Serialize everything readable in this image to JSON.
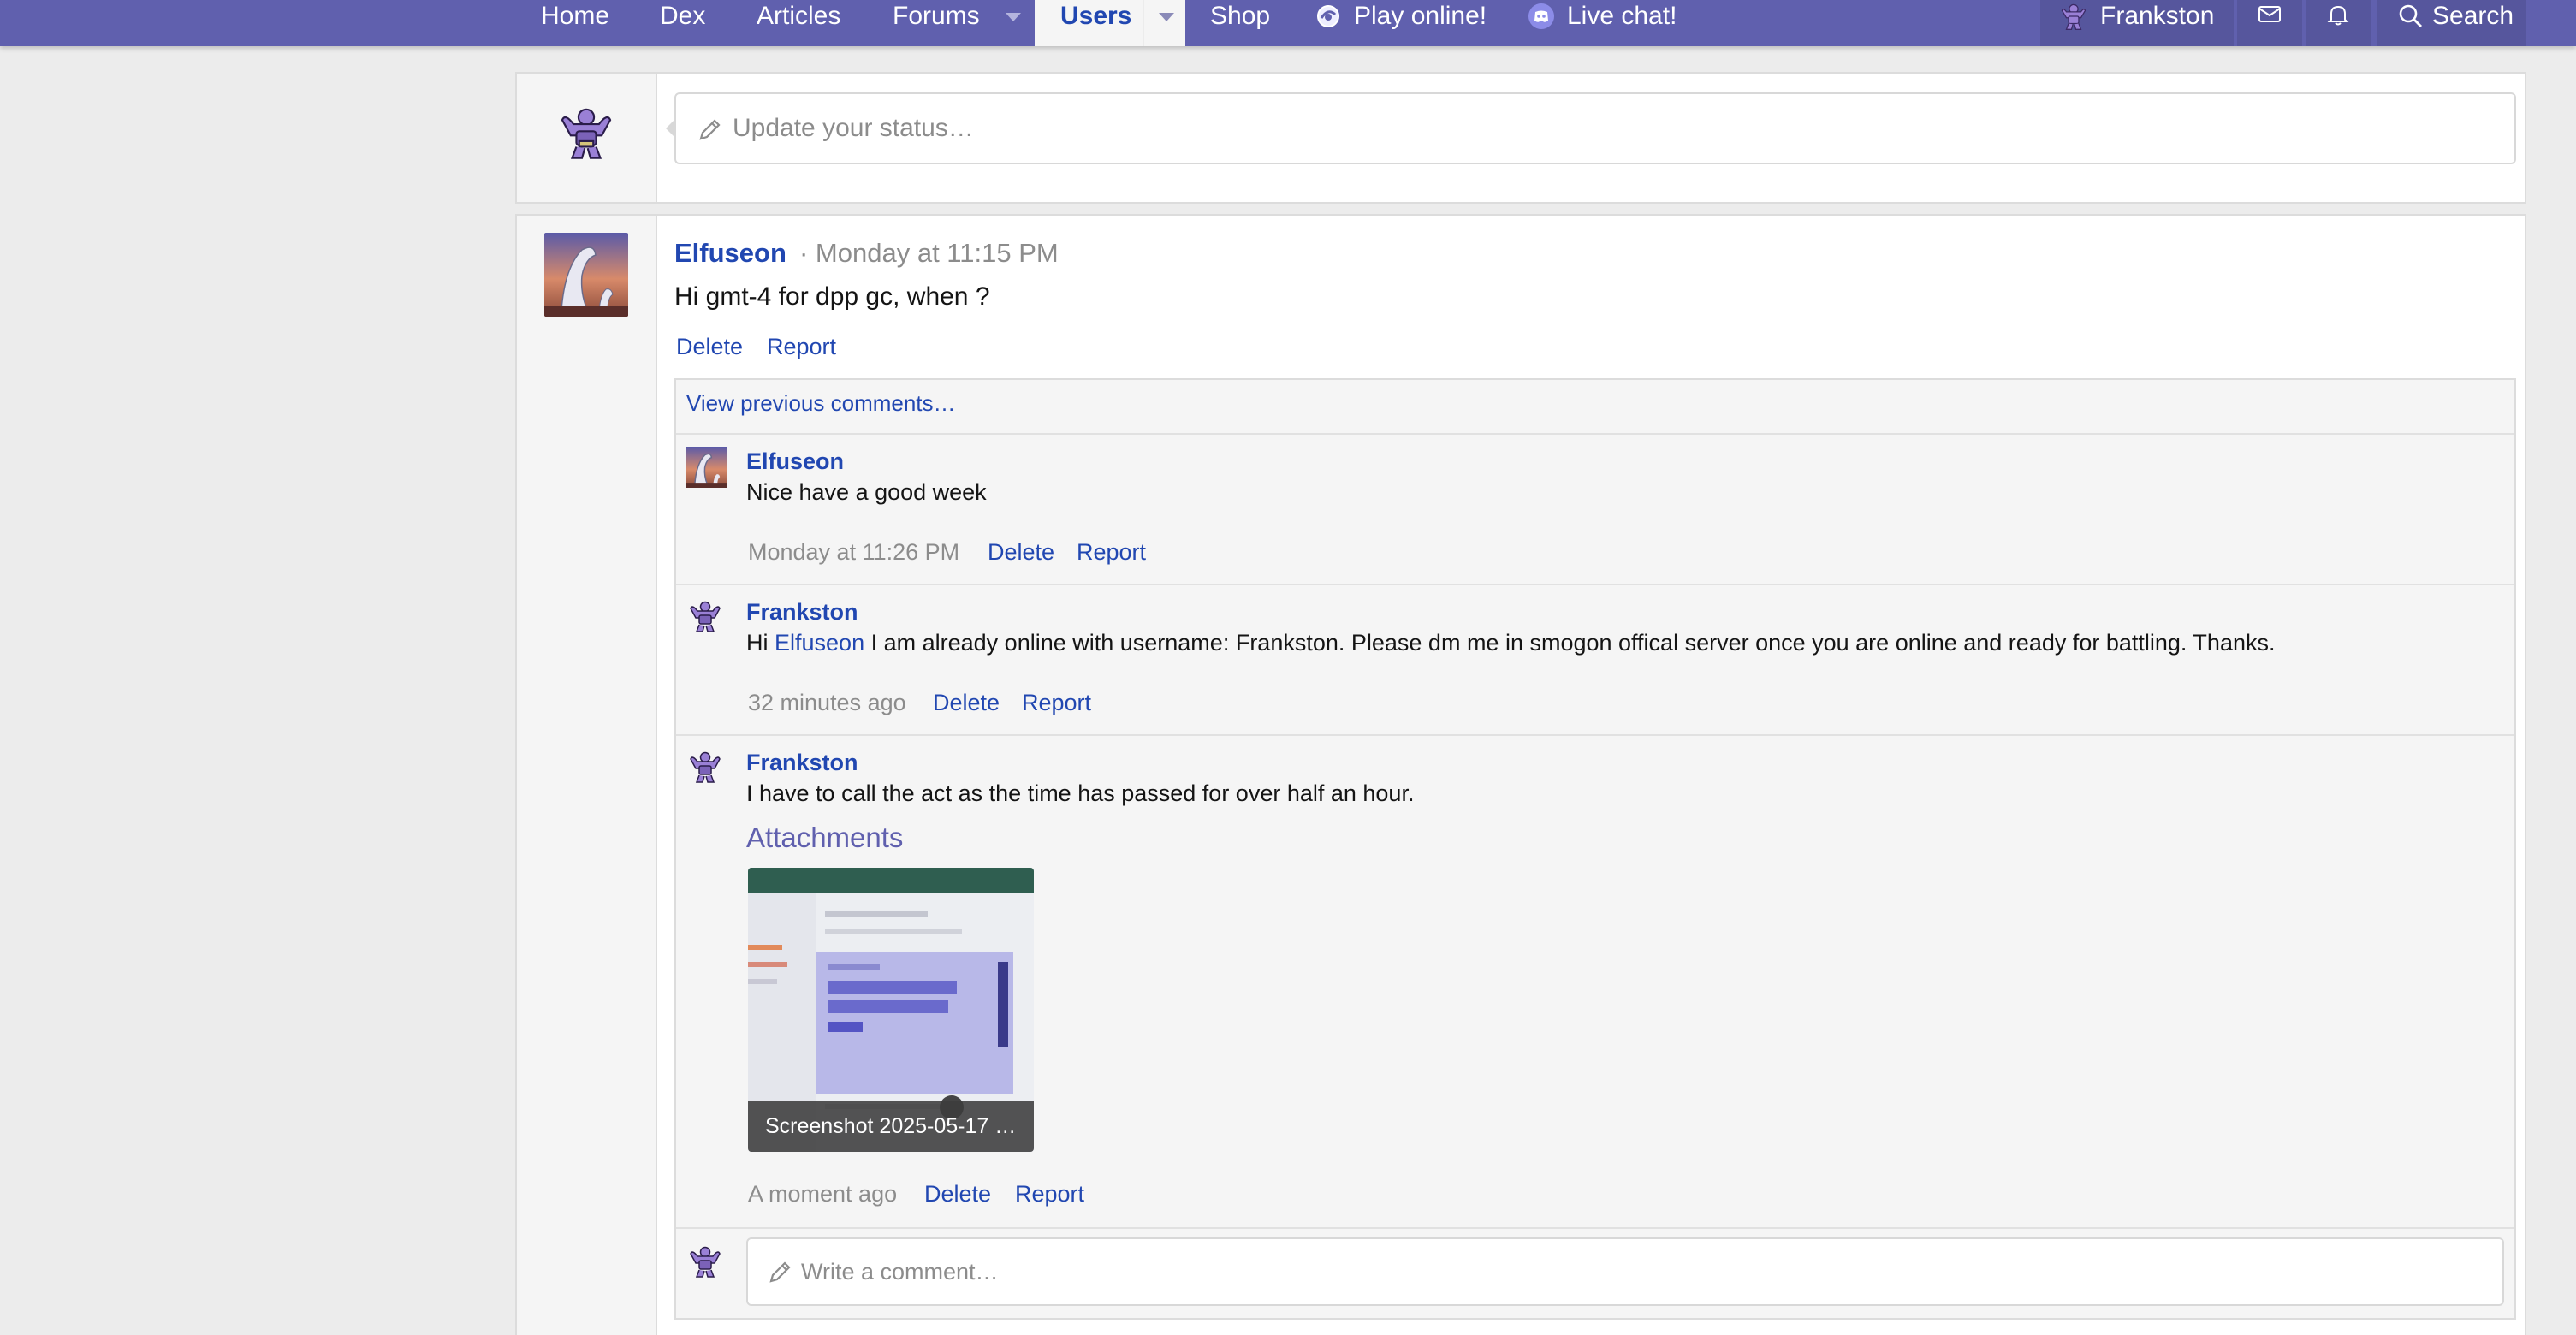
{
  "nav": {
    "items": [
      {
        "label": "Home"
      },
      {
        "label": "Dex"
      },
      {
        "label": "Articles"
      },
      {
        "label": "Forums"
      },
      {
        "label": "Users"
      },
      {
        "label": "Shop"
      },
      {
        "label": "Play online!"
      },
      {
        "label": "Live chat!"
      }
    ],
    "user": "Frankston",
    "search": "Search",
    "colors": {
      "bar": "#6060ae",
      "active_text": "#2147b1",
      "active_bg": "#f5f5f5"
    }
  },
  "status": {
    "placeholder": "Update your status…"
  },
  "post": {
    "author": "Elfuseon",
    "time": "· Monday at 11:15 PM",
    "text": "Hi gmt-4 for dpp gc, when ?",
    "delete": "Delete",
    "report": "Report",
    "view_previous": "View previous comments…",
    "comments": [
      {
        "author": "Elfuseon",
        "text": "Nice have a good week",
        "time": "Monday at 11:26 PM",
        "delete": "Delete",
        "report": "Report"
      },
      {
        "author": "Frankston",
        "text_prefix": "Hi",
        "mention": "Elfuseon",
        "text_suffix": "I am already online with username: Frankston. Please dm me in smogon offical server once you are online and ready for battling. Thanks.",
        "time": "32 minutes ago",
        "delete": "Delete",
        "report": "Report"
      },
      {
        "author": "Frankston",
        "text": "I have to call the act as the time has passed for over half an hour.",
        "attachments_title": "Attachments",
        "attachment_caption": "Screenshot 2025-05-17 …",
        "time": "A moment ago",
        "delete": "Delete",
        "report": "Report"
      }
    ],
    "write_placeholder": "Write a comment…"
  }
}
